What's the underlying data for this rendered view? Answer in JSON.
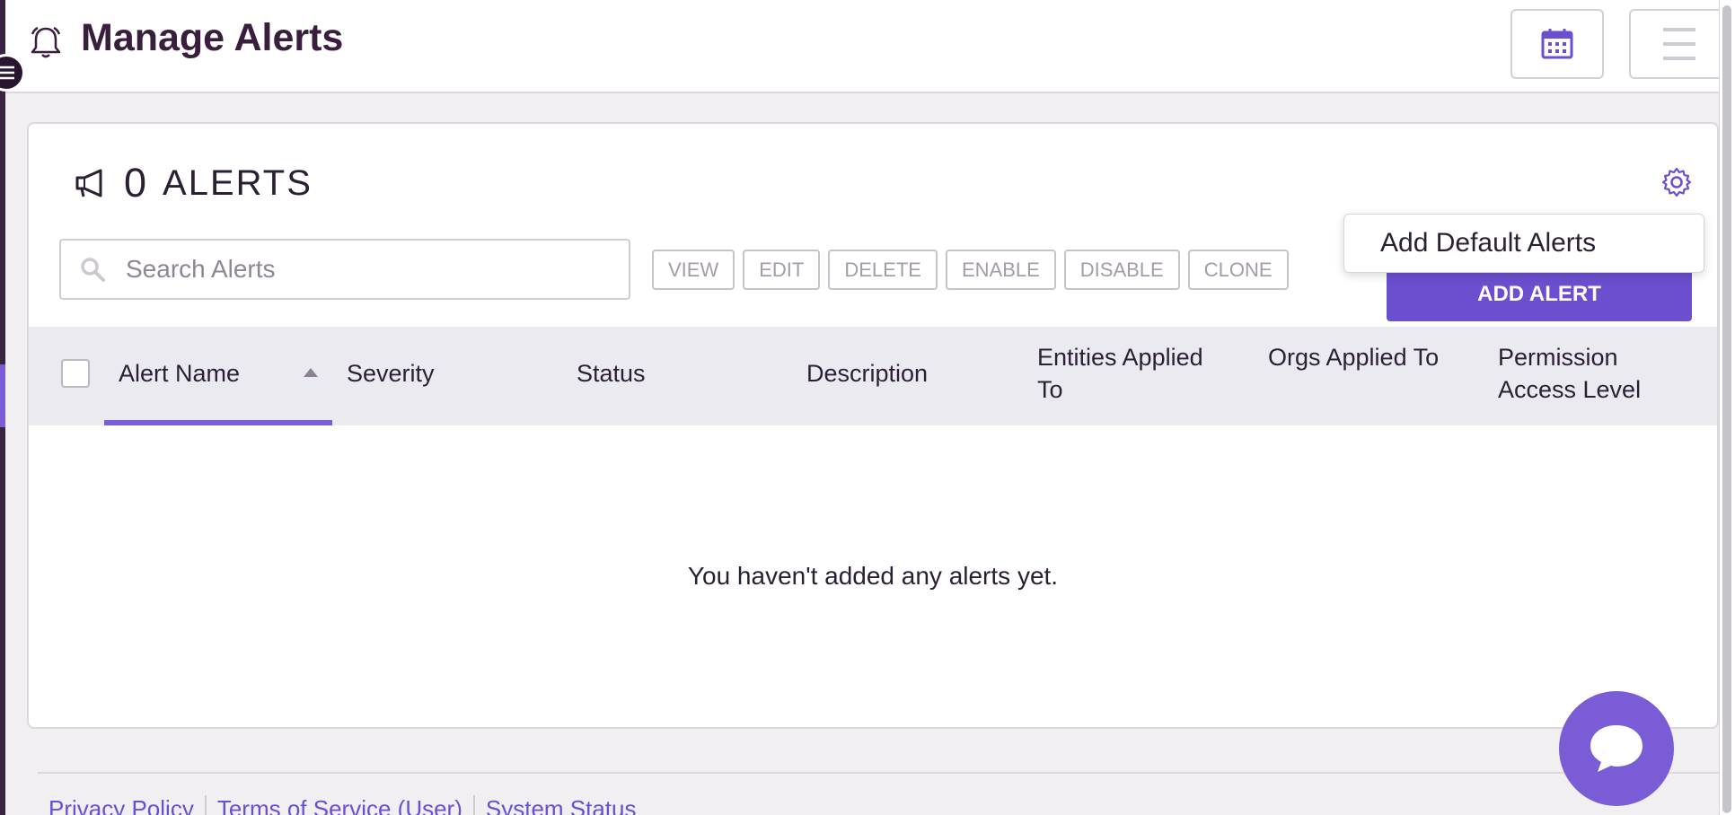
{
  "header": {
    "title": "Manage Alerts",
    "bell_icon": "bell-icon",
    "calendar_icon": "calendar-icon",
    "menu_icon": "hamburger-menu-icon"
  },
  "card": {
    "count": "0",
    "count_label": "ALERTS",
    "megaphone_icon": "megaphone-icon",
    "gear_icon": "gear-icon"
  },
  "search": {
    "placeholder": "Search Alerts",
    "value": ""
  },
  "actions": [
    "VIEW",
    "EDIT",
    "DELETE",
    "ENABLE",
    "DISABLE",
    "CLONE"
  ],
  "add_alert_label": "ADD ALERT",
  "dropdown": {
    "item": "Add Default Alerts"
  },
  "table": {
    "columns": [
      "Alert Name",
      "Severity",
      "Status",
      "Description",
      "Entities Applied To",
      "Orgs Applied To",
      "Permission Access Level"
    ],
    "sorted_column": "Alert Name",
    "sort_direction": "ascending",
    "empty_message": "You haven't added any alerts yet."
  },
  "footer": {
    "links": [
      "Privacy Policy",
      "Terms of Service (User)",
      "System Status"
    ]
  },
  "colors": {
    "accent": "#7a5cd6",
    "primary_button": "#6b4fcf",
    "title": "#3a1e3d",
    "table_header_bg": "#ebeaf0"
  }
}
